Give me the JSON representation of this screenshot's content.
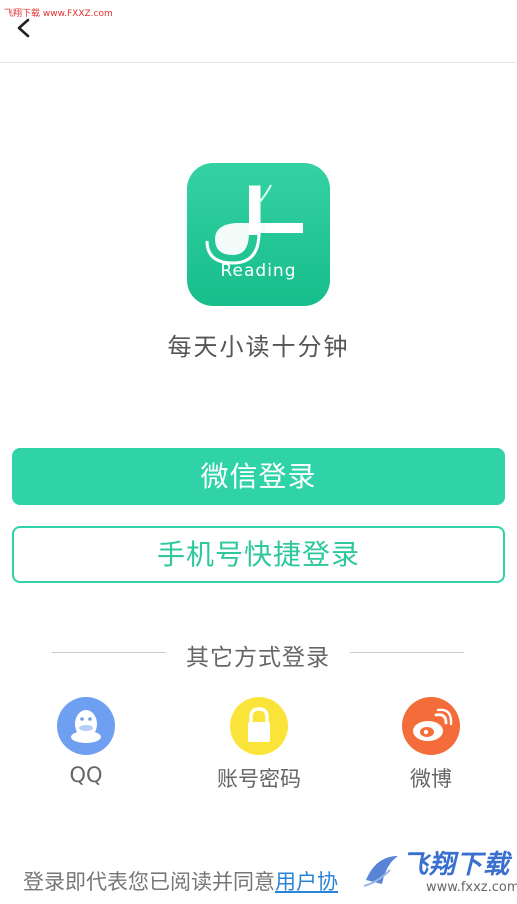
{
  "watermark": {
    "top_text": "飞翔下载 www.FXXZ.com",
    "bottom_title": "飞翔下载",
    "bottom_url": "www.fxxz.com"
  },
  "header": {
    "back_icon": "chevron-left-icon"
  },
  "app": {
    "logo_text": "Reading",
    "slogan": "每天小读十分钟",
    "brand_color": "#2fd3a7"
  },
  "buttons": {
    "wechat_login": "微信登录",
    "phone_login": "手机号快捷登录"
  },
  "alt_login": {
    "divider_text": "其它方式登录",
    "options": [
      {
        "label": "QQ",
        "icon": "qq-penguin-icon",
        "color": "#6f9ff0"
      },
      {
        "label": "账号密码",
        "icon": "lock-icon",
        "color": "#fbe43a"
      },
      {
        "label": "微博",
        "icon": "weibo-icon",
        "color": "#f46c3a"
      }
    ]
  },
  "agreement": {
    "prefix": "登录即代表您已阅读并同意",
    "link": "用户协"
  }
}
